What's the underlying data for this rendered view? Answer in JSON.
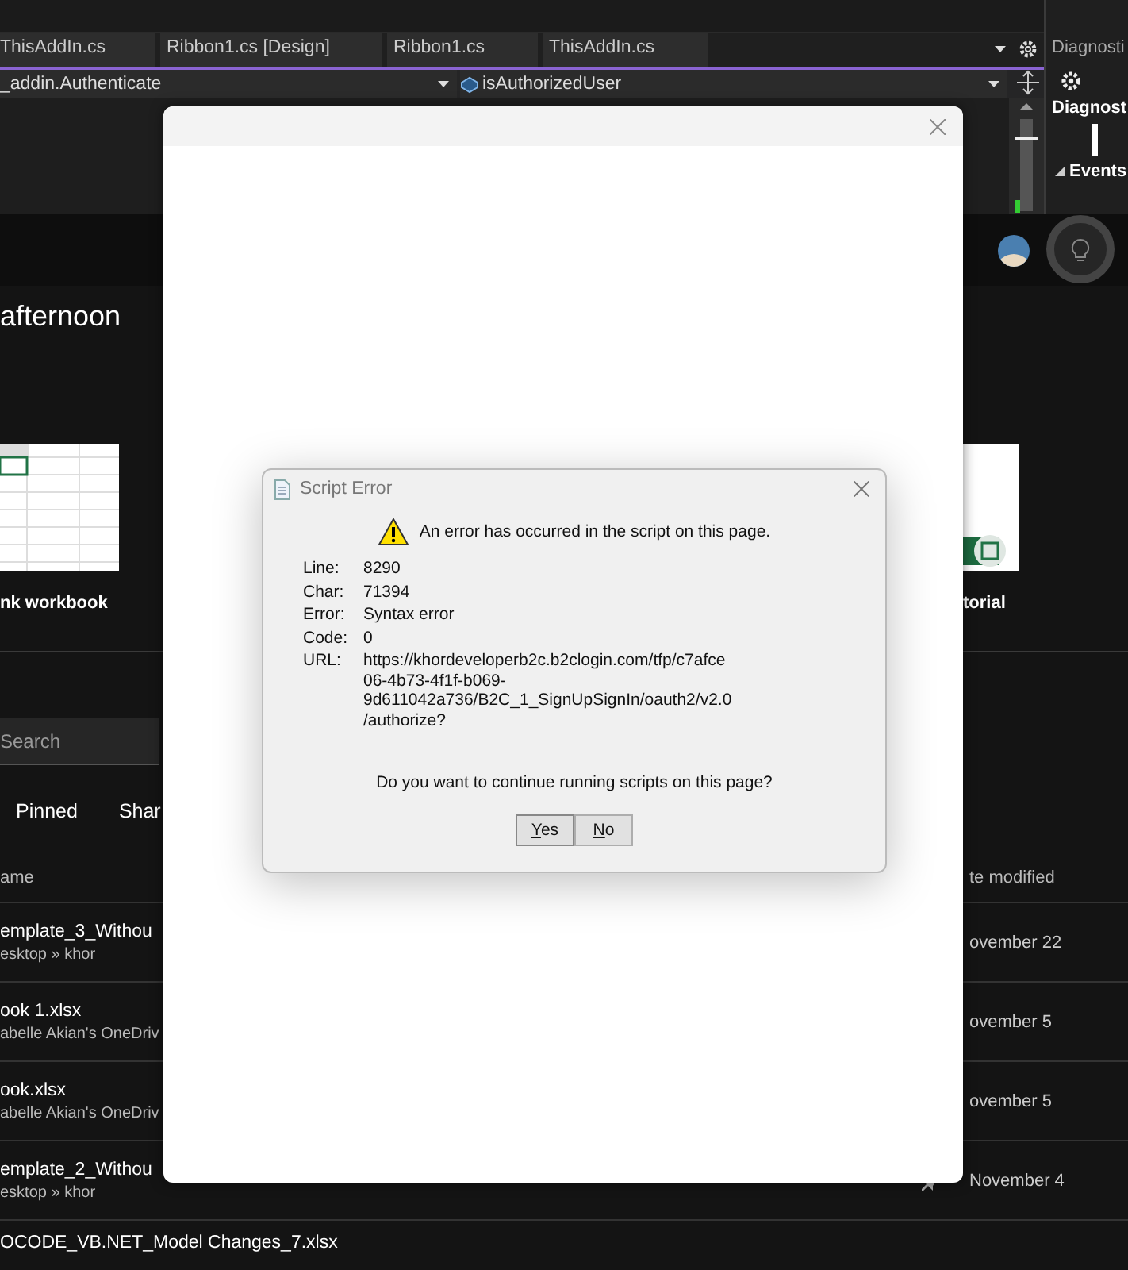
{
  "ide": {
    "tabs": [
      {
        "label": "ThisAddIn.cs",
        "selected": false
      },
      {
        "label": "Ribbon1.cs [Design]",
        "selected": false
      },
      {
        "label": "Ribbon1.cs",
        "selected": false
      },
      {
        "label": "ThisAddIn.cs",
        "selected": false
      }
    ],
    "member_dropdown": "_addin.Authenticate",
    "method_dropdown": "isAuthorizedUser",
    "side_panel": {
      "title": "Diagnosti",
      "heading": "Diagnost",
      "section": "Events"
    }
  },
  "excel": {
    "greeting": "afternoon",
    "templates": [
      {
        "label": "nk workbook",
        "kind": "sheet"
      },
      {
        "label": "torial",
        "kind": "tour"
      }
    ],
    "search": {
      "placeholder": "Search"
    },
    "filters": [
      {
        "label": "Pinned",
        "selected": false
      },
      {
        "label": "Shar",
        "selected": false
      }
    ],
    "columns": [
      "ame",
      "te modified"
    ],
    "files": [
      {
        "name": "emplate_3_Withou",
        "location": "esktop » khor",
        "modified": "ovember 22"
      },
      {
        "name": "ook 1.xlsx",
        "location": "abelle Akian's OneDriv",
        "modified": "ovember 5"
      },
      {
        "name": "ook.xlsx",
        "location": "abelle Akian's OneDriv",
        "modified": "ovember 5"
      },
      {
        "name": "emplate_2_Withou",
        "location": "esktop » khor",
        "modified": "November 4",
        "pinned": true
      },
      {
        "name": "OCODE_VB.NET_Model Changes_7.xlsx",
        "pinned": false
      }
    ]
  },
  "script_error": {
    "title": "Script Error",
    "message": "An error has occurred in the script on this page.",
    "details": [
      {
        "label": "Line:",
        "value": "8290"
      },
      {
        "label": "Char:",
        "value": "71394"
      },
      {
        "label": "Error:",
        "value": "Syntax error"
      },
      {
        "label": "Code:",
        "value": "0"
      },
      {
        "label": "URL:",
        "value": "https://khordeveloperb2c.b2clogin.com/tfp/c7afce06-4b73-4f1f-b069-9d611042a736/B2C_1_SignUpSignIn/oauth2/v2.0/authorize?"
      }
    ],
    "question": "Do you want to continue running scripts on this page?",
    "buttons": [
      {
        "label": "Yes",
        "default": true
      },
      {
        "label": "No",
        "default": false
      }
    ]
  }
}
